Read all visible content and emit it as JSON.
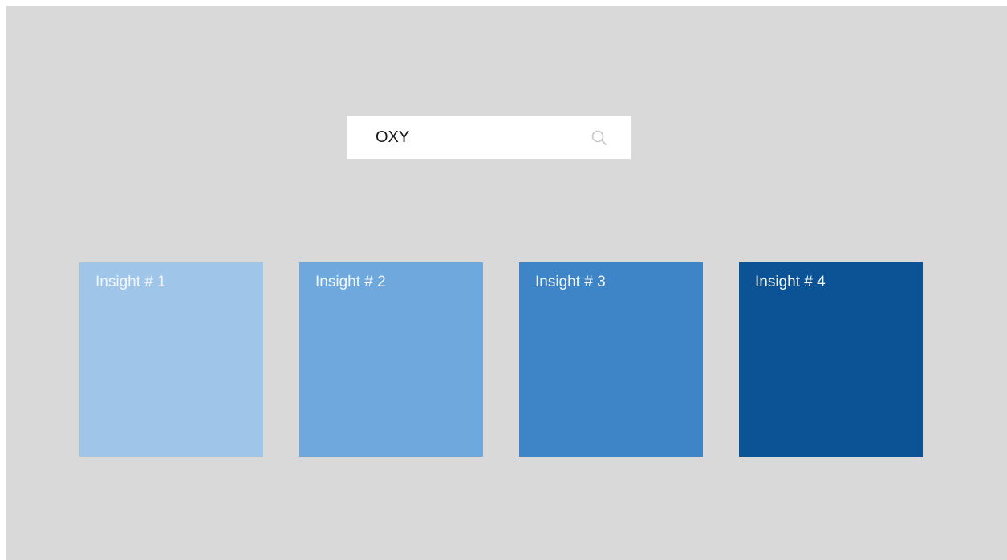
{
  "search": {
    "value": "OXY",
    "icon": "search-icon"
  },
  "insights": [
    {
      "label": "Insight # 1",
      "color": "#9fc5e8"
    },
    {
      "label": "Insight # 2",
      "color": "#6fa8dc"
    },
    {
      "label": "Insight # 3",
      "color": "#3d85c6"
    },
    {
      "label": "Insight # 4",
      "color": "#0b5394"
    }
  ],
  "colors": {
    "background": "#d9d9d9",
    "search_bg": "#ffffff",
    "card_text": "#f2f6fb"
  }
}
